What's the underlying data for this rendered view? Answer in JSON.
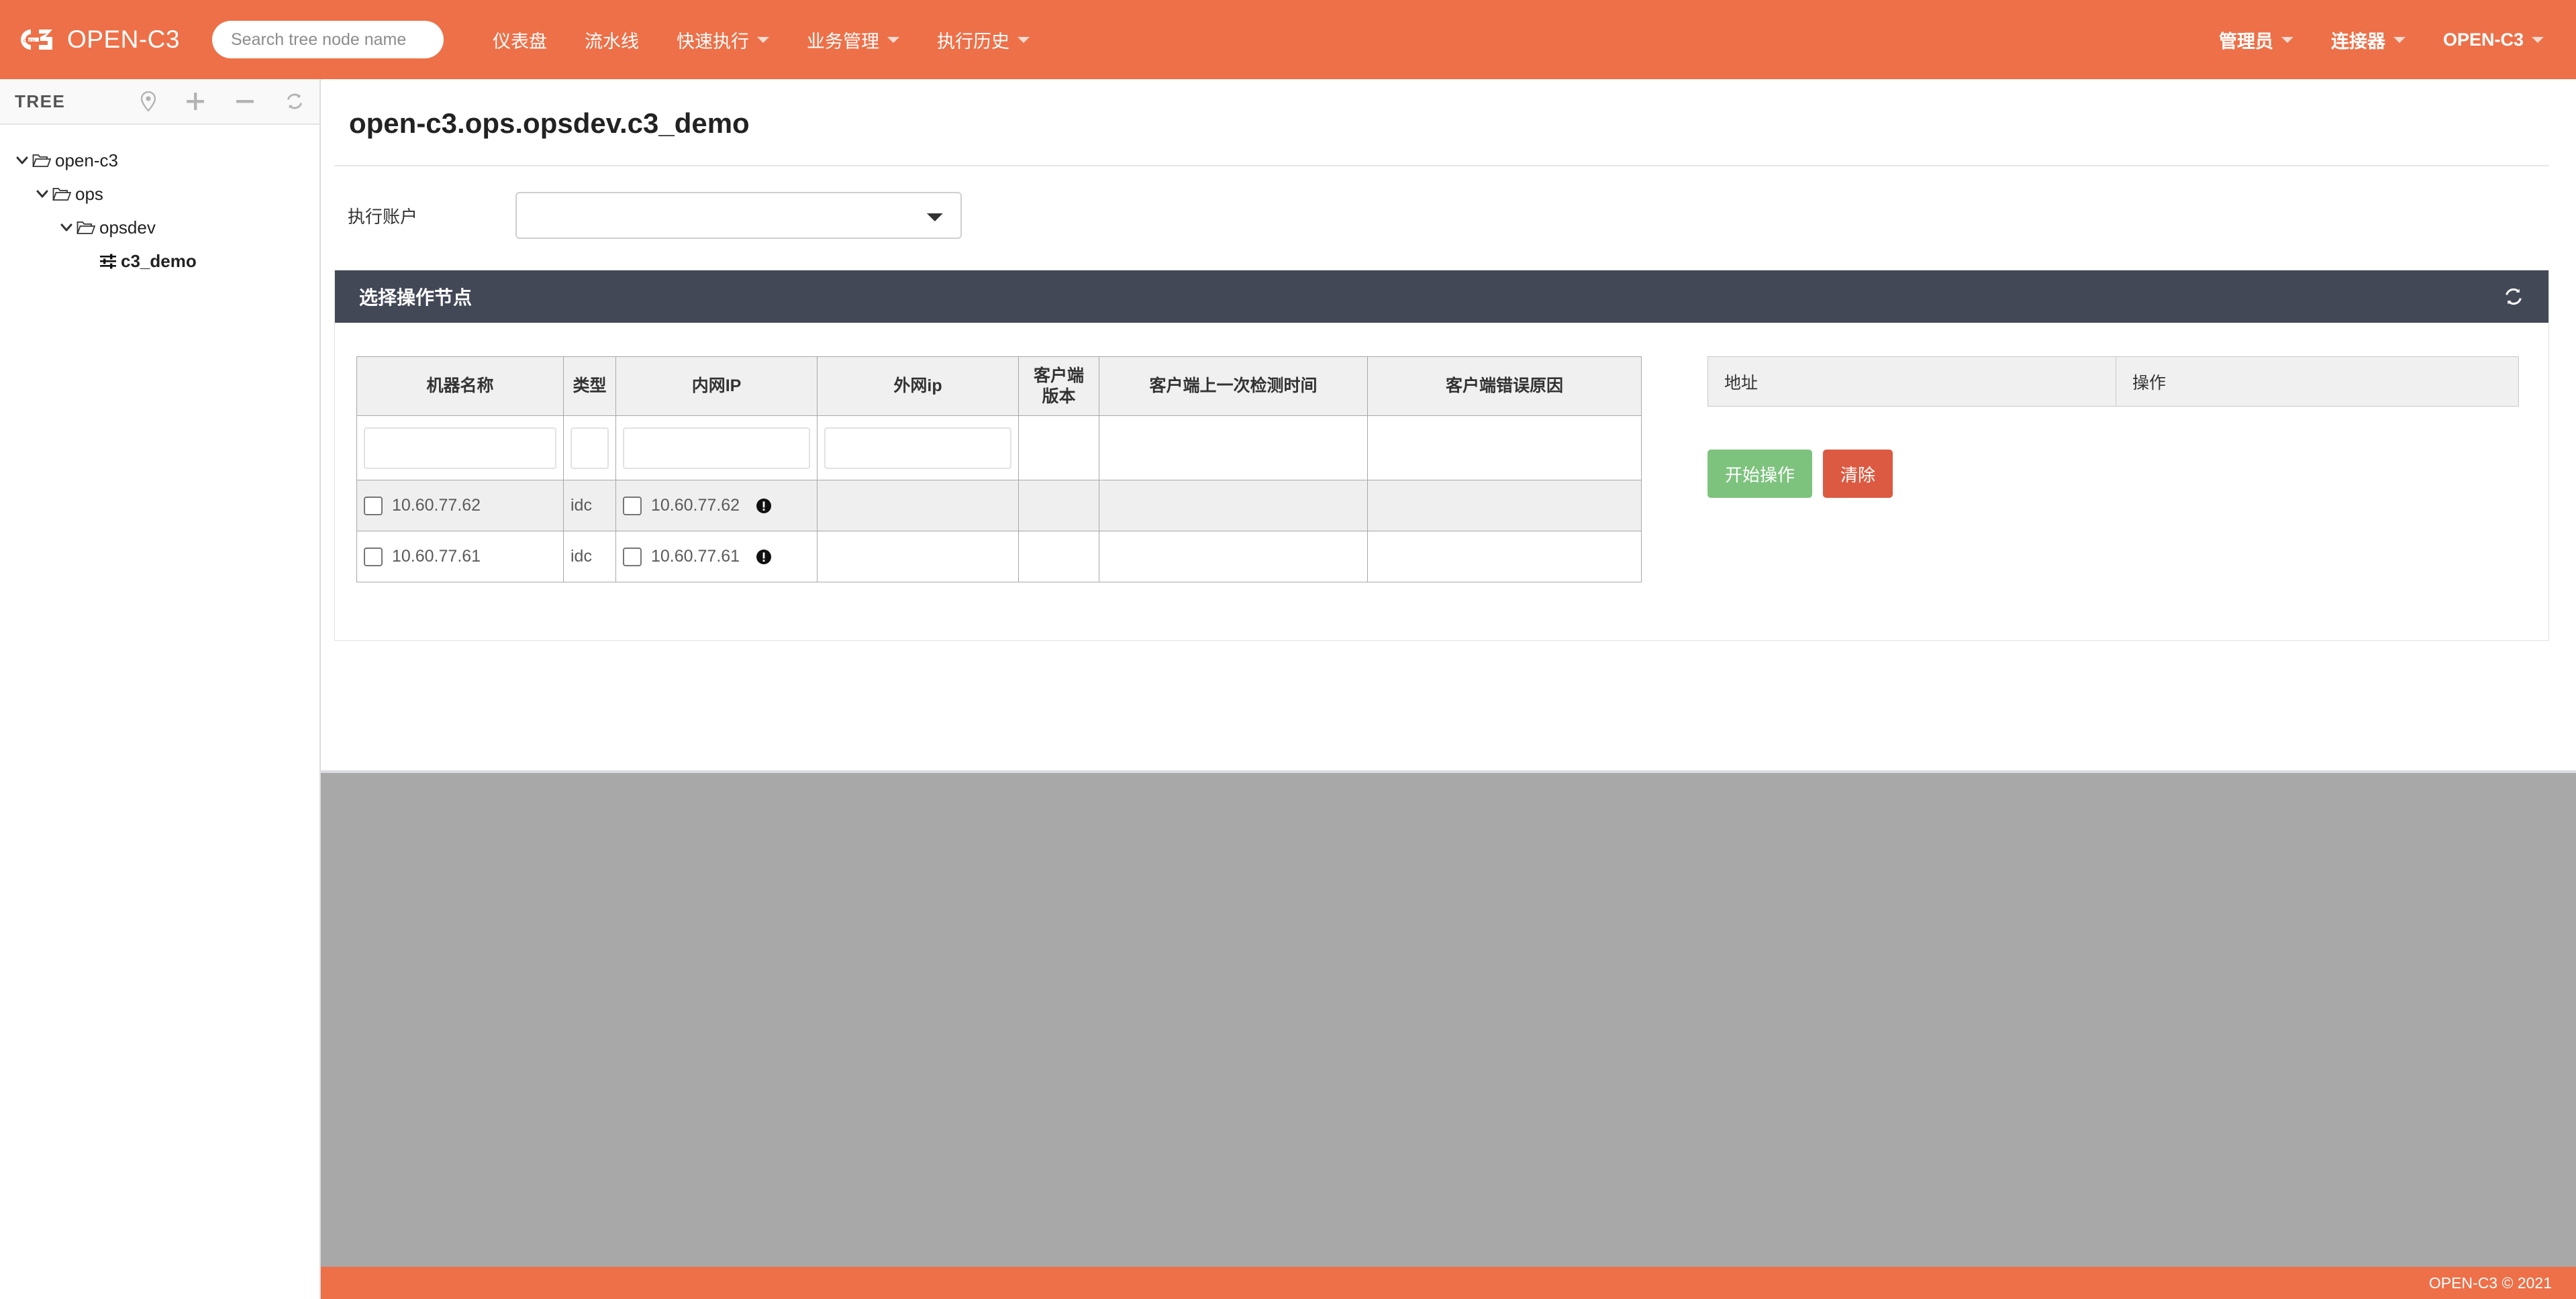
{
  "navbar": {
    "brand": "OPEN-C3",
    "logo_icon": "c3-logo-icon",
    "search": {
      "placeholder": "Search tree node name",
      "value": ""
    },
    "links": [
      {
        "label": "仪表盘",
        "has_caret": false
      },
      {
        "label": "流水线",
        "has_caret": false
      },
      {
        "label": "快速执行",
        "has_caret": true
      },
      {
        "label": "业务管理",
        "has_caret": true
      },
      {
        "label": "执行历史",
        "has_caret": true
      }
    ],
    "right_links": [
      {
        "label": "管理员",
        "has_caret": true
      },
      {
        "label": "连接器",
        "has_caret": true
      },
      {
        "label": "OPEN-C3",
        "has_caret": true
      }
    ]
  },
  "sidebar": {
    "title": "TREE",
    "tools": [
      {
        "name": "locate-icon"
      },
      {
        "name": "add-icon"
      },
      {
        "name": "remove-icon"
      },
      {
        "name": "refresh-icon"
      }
    ],
    "nodes": [
      {
        "label": "open-c3",
        "depth": 0,
        "type": "folder",
        "expanded": true
      },
      {
        "label": "ops",
        "depth": 1,
        "type": "folder",
        "expanded": true
      },
      {
        "label": "opsdev",
        "depth": 2,
        "type": "folder",
        "expanded": true
      },
      {
        "label": "c3_demo",
        "depth": 3,
        "type": "leaf",
        "expanded": false
      }
    ]
  },
  "main": {
    "page_title": "open-c3.ops.opsdev.c3_demo",
    "form": {
      "account_label": "执行账户",
      "account_value": "",
      "account_options": [
        ""
      ]
    },
    "panel": {
      "title": "选择操作节点",
      "refresh_icon": "refresh-icon"
    },
    "node_table": {
      "headers": [
        "机器名称",
        "类型",
        "内网IP",
        "外网ip",
        "客户端\n版本",
        "客户端上一次检测时间",
        "客户端错误原因"
      ],
      "header_machine": "机器名称",
      "header_type": "类型",
      "header_intranet_ip": "内网IP",
      "header_extranet_ip": "外网ip",
      "header_client_version_l1": "客户端",
      "header_client_version_l2": "版本",
      "header_last_check": "客户端上一次检测时间",
      "header_error_reason": "客户端错误原因",
      "filters": {
        "machine": "",
        "type": "",
        "intranet_ip": "",
        "extranet_ip": ""
      },
      "rows": [
        {
          "machine": "10.60.77.62",
          "type": "idc",
          "intranet_ip": "10.60.77.62",
          "extranet_ip": "",
          "client_version": "",
          "last_check": "",
          "error_reason": "",
          "info_icon": "exclamation-circle-icon",
          "checked": false
        },
        {
          "machine": "10.60.77.61",
          "type": "idc",
          "intranet_ip": "10.60.77.61",
          "extranet_ip": "",
          "client_version": "",
          "last_check": "",
          "error_reason": "",
          "info_icon": "exclamation-circle-icon",
          "checked": false
        }
      ]
    },
    "selected_table": {
      "header_address": "地址",
      "header_action": "操作",
      "rows": []
    },
    "actions": {
      "start_label": "开始操作",
      "clear_label": "清除"
    }
  },
  "footer": {
    "text": "OPEN-C3 © 2021"
  },
  "colors": {
    "brand_orange": "#ED7048",
    "panel_dark": "#434857",
    "button_green": "#7DC37E",
    "button_red": "#DC5A41",
    "grey_area": "#a8a8a8"
  }
}
